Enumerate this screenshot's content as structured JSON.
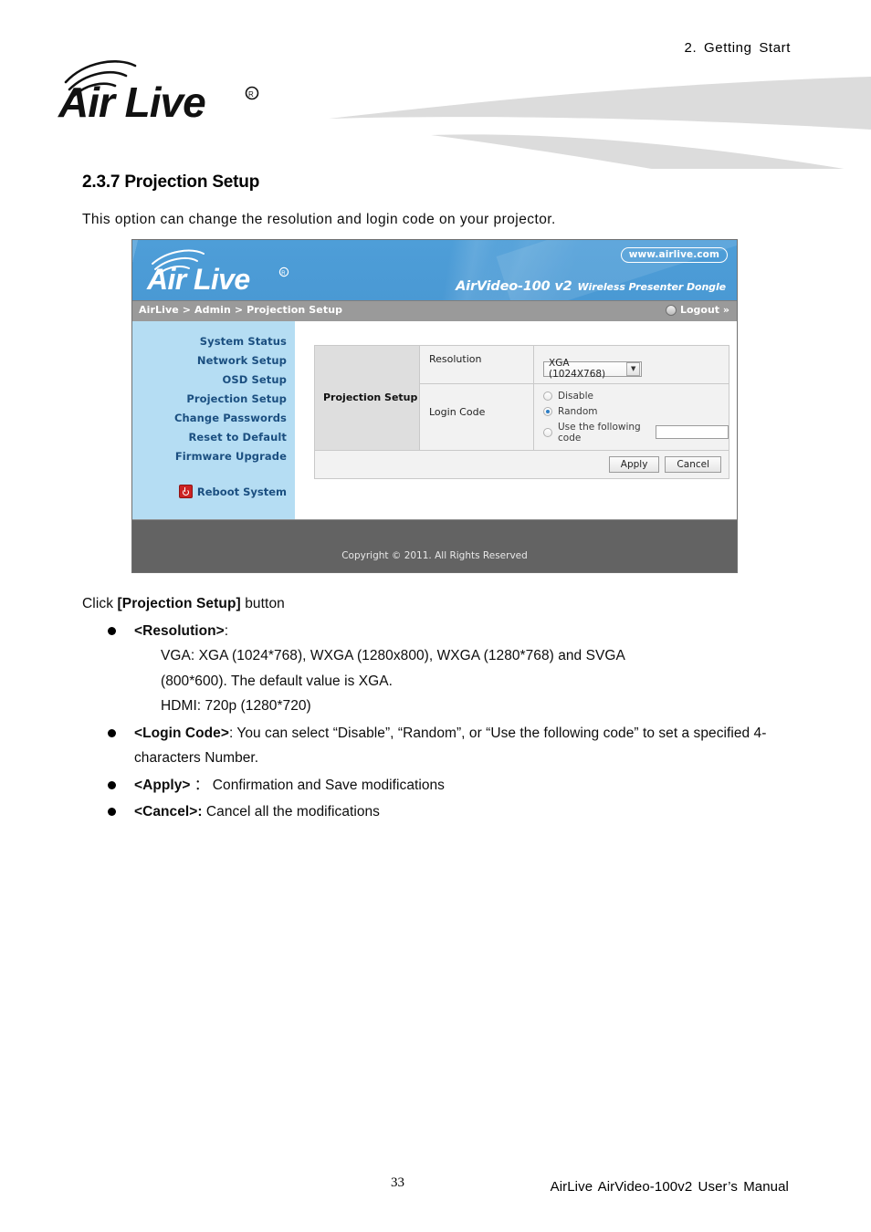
{
  "page": {
    "running_head": "2.  Getting  Start",
    "brand_logo_text": "AirLive",
    "section_number_title": "2.3.7 Projection Setup",
    "intro": "This option can change the resolution and login code on your projector.",
    "page_number": "33",
    "manual_footer": "AirLive  AirVideo-100v2  User’s  Manual"
  },
  "screenshot": {
    "banner": {
      "logo_text": "AirLive",
      "url_badge": "www.airlive.com",
      "product_model": "AirVideo-100 v2",
      "product_tagline": "Wireless Presenter Dongle"
    },
    "breadcrumb": "AirLive > Admin > Projection Setup",
    "logout_label": "Logout »",
    "sidebar": {
      "items": [
        {
          "label": "System Status"
        },
        {
          "label": "Network Setup"
        },
        {
          "label": "OSD Setup"
        },
        {
          "label": "Projection Setup"
        },
        {
          "label": "Change Passwords"
        },
        {
          "label": "Reset to Default"
        },
        {
          "label": "Firmware Upgrade"
        }
      ],
      "reboot_label": "Reboot System"
    },
    "panel": {
      "title": "Projection Setup",
      "resolution": {
        "label": "Resolution",
        "selected_value": "XGA (1024X768)",
        "options": [
          "XGA (1024X768)",
          "WXGA (1280x800)",
          "WXGA (1280*768)",
          "SVGA (800*600)",
          "720p (1280*720)"
        ]
      },
      "login_code": {
        "label": "Login Code",
        "options": [
          {
            "label": "Disable",
            "selected": false
          },
          {
            "label": "Random",
            "selected": true
          },
          {
            "label": "Use the following code",
            "selected": false
          }
        ],
        "code_value": ""
      },
      "apply_label": "Apply",
      "cancel_label": "Cancel"
    },
    "footer_copyright": "Copyright © 2011. All Rights Reserved",
    "colors": {
      "banner_blue": "#4e9ed8",
      "sidebar_blue": "#b5ddf3",
      "sidebar_text": "#1b4f80",
      "crumb_gray": "#9a9a9a",
      "footer_gray": "#636363",
      "reboot_icon_red": "#cc2222"
    }
  },
  "body_copy": {
    "lead_prefix": "Click ",
    "lead_bold": "[Projection Setup]",
    "lead_suffix": " button",
    "bullets": [
      {
        "term": "<Resolution>",
        "term_suffix": ":",
        "text": "",
        "sub_lines": [
          "VGA: XGA (1024*768), WXGA (1280x800), WXGA (1280*768) and SVGA",
          "(800*600). The default value is XGA.",
          "HDMI: 720p (1280*720)"
        ]
      },
      {
        "term": "<Login Code>",
        "term_suffix": ":",
        "text": " You can select “Disable”, “Random”, or “Use the following code” to set a specified 4-characters Number.",
        "sub_lines": []
      },
      {
        "term": "<Apply>",
        "term_suffix": " ：",
        "text": " Confirmation and Save modifications",
        "sub_lines": []
      },
      {
        "term": "<Cancel>:",
        "term_suffix": "",
        "text": " Cancel all the modifications",
        "sub_lines": []
      }
    ]
  }
}
